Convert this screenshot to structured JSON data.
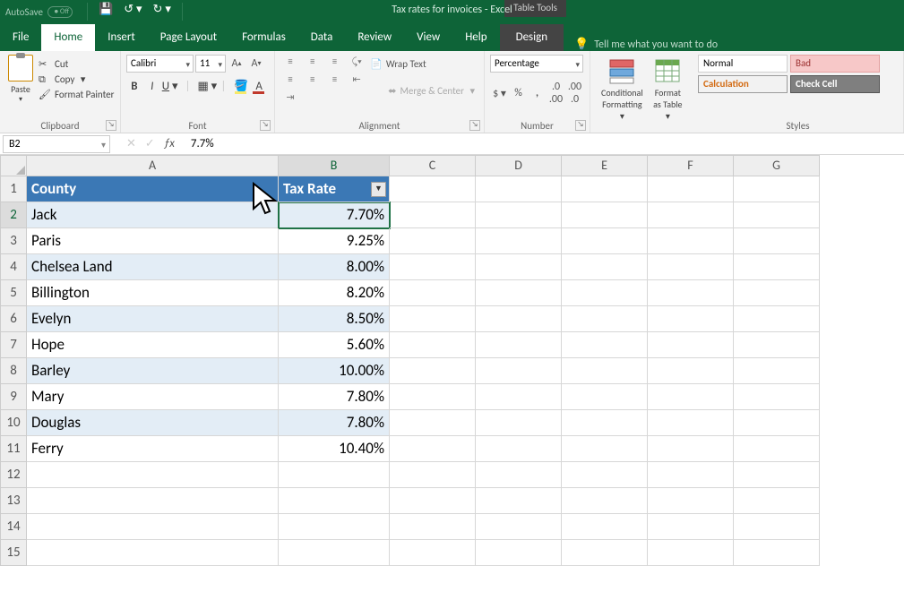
{
  "titlebar": {
    "autosave_label": "AutoSave",
    "autosave_off": "Off",
    "doc_title": "Tax rates for invoices  -  Excel",
    "context_tab_group": "Table Tools"
  },
  "tabs": {
    "file": "File",
    "home": "Home",
    "insert": "Insert",
    "page_layout": "Page Layout",
    "formulas": "Formulas",
    "data": "Data",
    "review": "Review",
    "view": "View",
    "help": "Help",
    "design": "Design",
    "tellme_placeholder": "Tell me what you want to do"
  },
  "ribbon": {
    "clipboard": {
      "paste": "Paste",
      "cut": "Cut",
      "copy": "Copy",
      "format_painter": "Format Painter",
      "label": "Clipboard"
    },
    "font": {
      "name": "Calibri",
      "size": "11",
      "label": "Font"
    },
    "alignment": {
      "wrap": "Wrap Text",
      "merge": "Merge & Center",
      "label": "Alignment"
    },
    "number": {
      "format": "Percentage",
      "label": "Number"
    },
    "columns": {
      "cond_fmt": "Conditional Formatting",
      "fmt_table": "Format as Table"
    },
    "styles": {
      "normal": "Normal",
      "bad": "Bad",
      "calc": "Calculation",
      "check": "Check Cell",
      "label": "Styles"
    }
  },
  "formula_bar": {
    "cell_ref": "B2",
    "value": "7.7%"
  },
  "columns": [
    "A",
    "B",
    "C",
    "D",
    "E",
    "F",
    "G"
  ],
  "table": {
    "headers": {
      "a": "County",
      "b": "Tax Rate"
    },
    "rows": [
      {
        "county": "Jack",
        "rate": "7.70%"
      },
      {
        "county": "Paris",
        "rate": "9.25%"
      },
      {
        "county": "Chelsea Land",
        "rate": "8.00%"
      },
      {
        "county": "Billington",
        "rate": "8.20%"
      },
      {
        "county": "Evelyn",
        "rate": "8.50%"
      },
      {
        "county": "Hope",
        "rate": "5.60%"
      },
      {
        "county": "Barley",
        "rate": "10.00%"
      },
      {
        "county": "Mary",
        "rate": "7.80%"
      },
      {
        "county": "Douglas",
        "rate": "7.80%"
      },
      {
        "county": "Ferry",
        "rate": "10.40%"
      }
    ]
  }
}
